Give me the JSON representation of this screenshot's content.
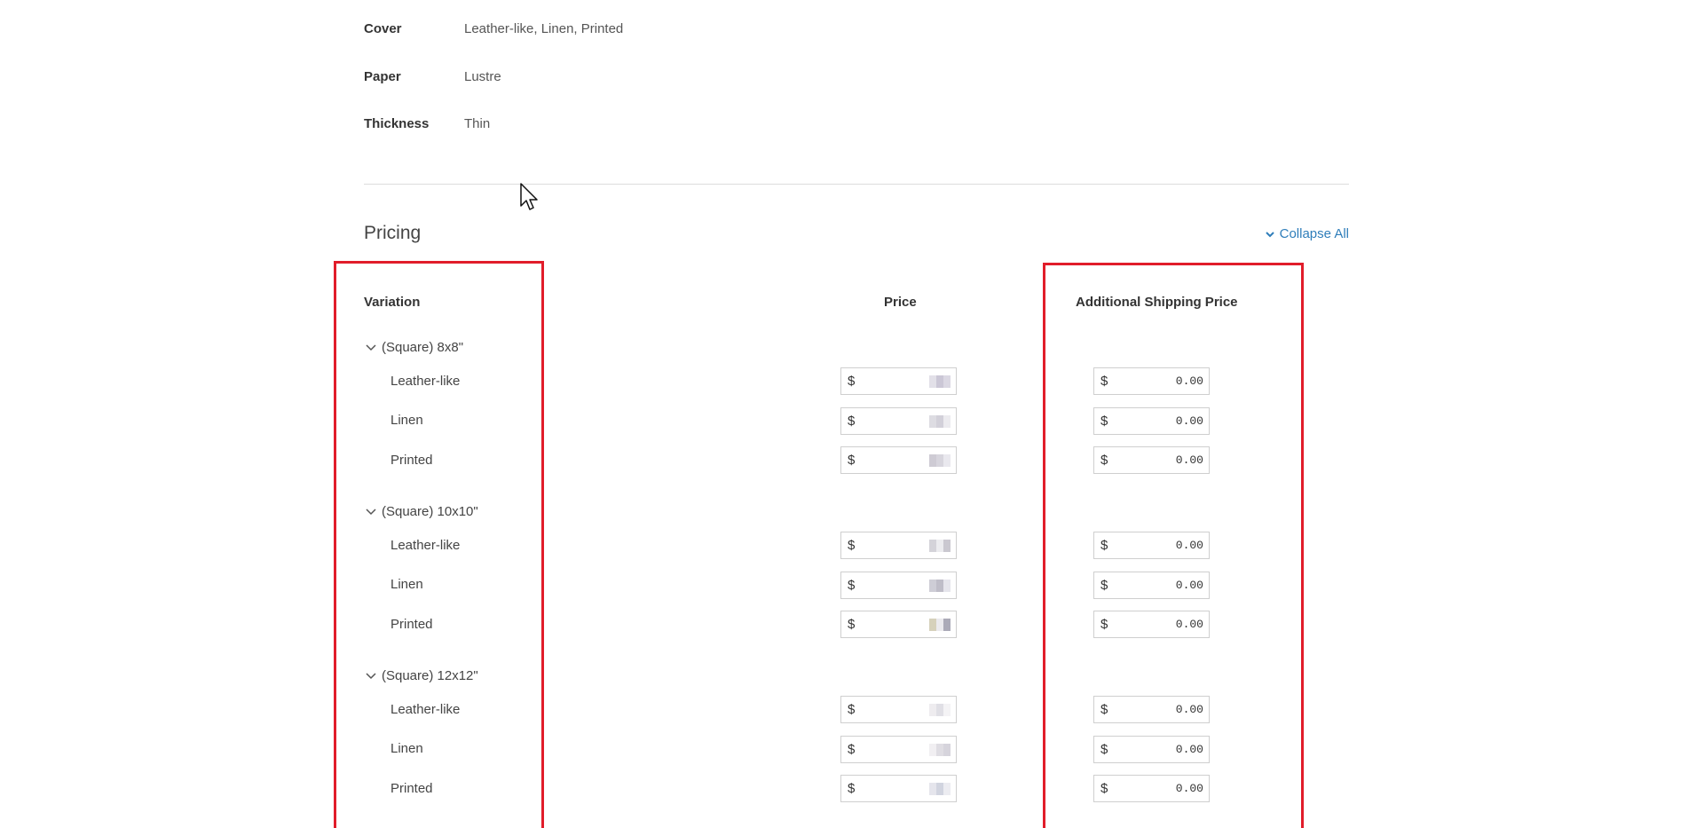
{
  "specs": [
    {
      "label": "Cover",
      "value": "Leather-like, Linen, Printed"
    },
    {
      "label": "Paper",
      "value": "Lustre"
    },
    {
      "label": "Thickness",
      "value": "Thin"
    }
  ],
  "pricing": {
    "title": "Pricing",
    "collapse_all": "Collapse All",
    "columns": {
      "variation": "Variation",
      "price": "Price",
      "shipping": "Additional Shipping Price"
    },
    "currency": "$",
    "groups": [
      {
        "label": "(Square) 8x8\"",
        "items": [
          {
            "label": "Leather-like",
            "shipping": "0.00"
          },
          {
            "label": "Linen",
            "shipping": "0.00"
          },
          {
            "label": "Printed",
            "shipping": "0.00"
          }
        ]
      },
      {
        "label": "(Square) 10x10\"",
        "items": [
          {
            "label": "Leather-like",
            "shipping": "0.00"
          },
          {
            "label": "Linen",
            "shipping": "0.00"
          },
          {
            "label": "Printed",
            "shipping": "0.00"
          }
        ]
      },
      {
        "label": "(Square) 12x12\"",
        "items": [
          {
            "label": "Leather-like",
            "shipping": "0.00"
          },
          {
            "label": "Linen",
            "shipping": "0.00"
          },
          {
            "label": "Printed",
            "shipping": "0.00"
          }
        ]
      }
    ]
  },
  "colors": {
    "accent": "#2f7eba",
    "highlight": "#e11d2a"
  },
  "icons": {
    "group_toggle": "chevron-down-icon",
    "collapse_all": "chevron-down-icon",
    "cursor": "mouse-pointer-icon"
  }
}
